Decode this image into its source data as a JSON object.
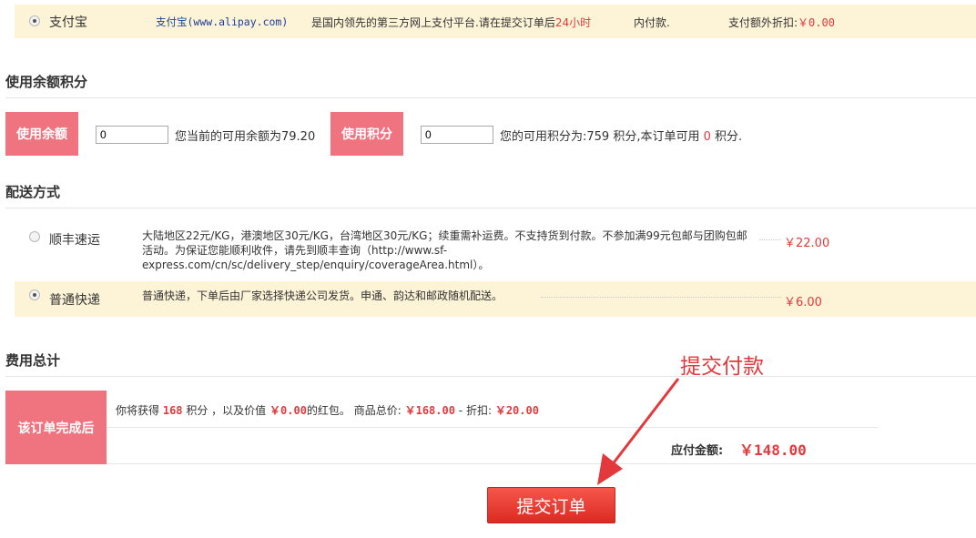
{
  "payment": {
    "alipay": {
      "name": "支付宝",
      "link": "支付宝(www.alipay.com)",
      "desc_prefix": "是国内领先的第三方网上支付平台.请在提交订单后",
      "desc_hours": "24小时",
      "desc_suffix": "内付款.",
      "discount_label": "支付额外折扣:",
      "discount_value": "￥0.00",
      "selected": true
    }
  },
  "balance": {
    "title": "使用余额积分",
    "balance_label": "使用余额",
    "balance_input": "0",
    "balance_info": "您当前的可用余额为79.20",
    "points_label": "使用积分",
    "points_input": "0",
    "points_info_prefix": "您的可用积分为:759 积分,本订单可用",
    "points_usable": "0",
    "points_info_suffix": "积分."
  },
  "shipping": {
    "title": "配送方式",
    "options": [
      {
        "name": "顺丰速运",
        "desc": "大陆地区22元/KG，港澳地区30元/KG，台湾地区30元/KG；续重需补运费。不支持货到付款。不参加满99元包邮与团购包邮活动。为保证您能顺利收件，请先到顺丰查询（http://www.sf-express.com/cn/sc/delivery_step/enquiry/coverageArea.html）。",
        "price": "￥22.00",
        "selected": false
      },
      {
        "name": "普通快递",
        "desc": "普通快递，下单后由厂家选择快递公司发货。申通、韵达和邮政随机配送。",
        "price": "￥6.00",
        "selected": true
      }
    ]
  },
  "totals": {
    "title": "费用总计",
    "label": "该订单完成后",
    "earn_prefix": "你将获得",
    "earn_points": "168",
    "earn_mid": "积分 ，以及价值",
    "earn_coupon": "￥0.00",
    "earn_suffix": "的红包。 商品总价:",
    "goods_total": "￥168.00",
    "minus": "- 折扣:",
    "discount": "￥20.00",
    "payable_label": "应付金额:",
    "payable_value": "￥148.00"
  },
  "submit": {
    "label": "提交订单"
  },
  "annotation": {
    "text": "提交付款"
  },
  "colors": {
    "accent_red": "#e4393c",
    "pink_label": "#f07480",
    "highlight_bg": "#fdf3d6",
    "link_blue": "#1c3e9e"
  }
}
